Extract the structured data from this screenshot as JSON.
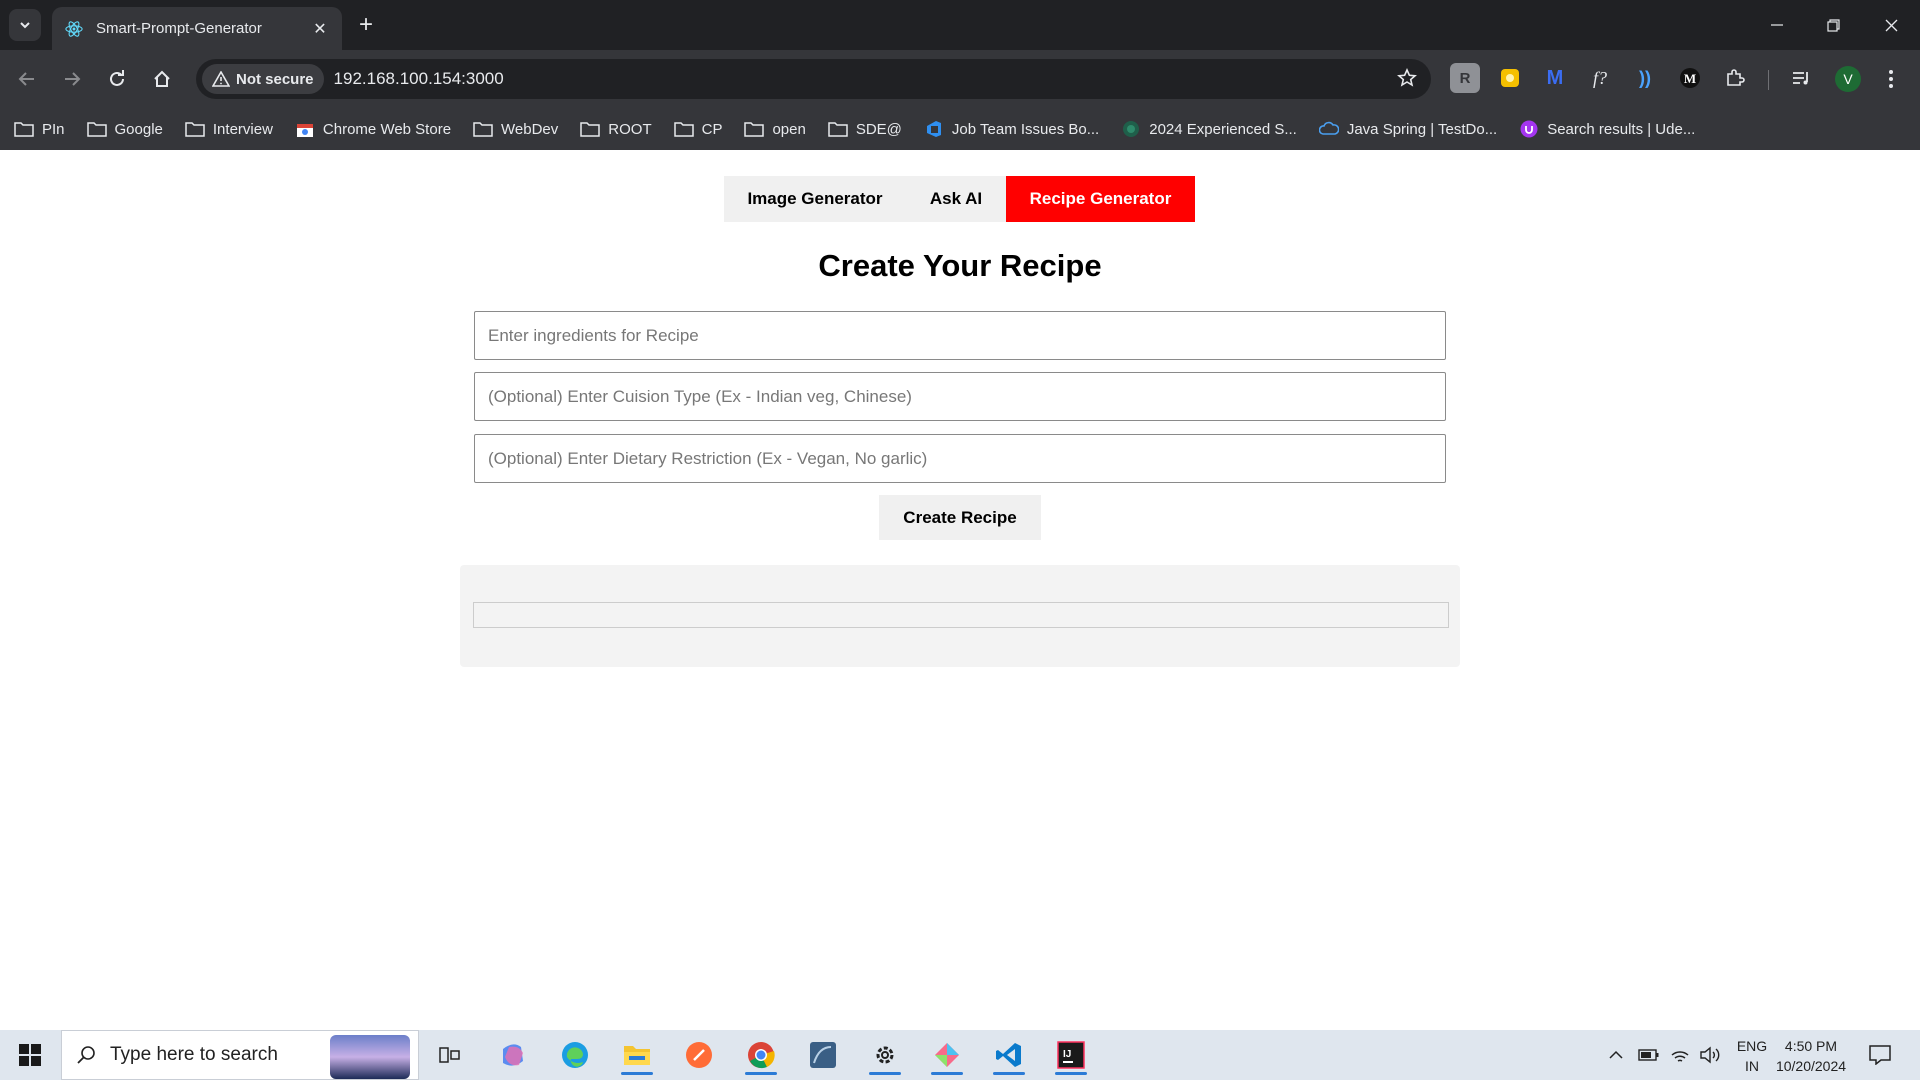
{
  "browser": {
    "tab_title": "Smart-Prompt-Generator",
    "security_label": "Not secure",
    "url": "192.168.100.154:3000",
    "profile_initial": "V",
    "bookmarks": [
      "PIn",
      "Google",
      "Interview",
      "Chrome Web Store",
      "WebDev",
      "ROOT",
      "CP",
      "open",
      "SDE@",
      "Job Team Issues Bo...",
      "2024 Experienced S...",
      "Java Spring | TestDo...",
      "Search results | Ude..."
    ]
  },
  "app": {
    "tabs": [
      "Image Generator",
      "Ask AI",
      "Recipe Generator"
    ],
    "active_tab": "Recipe Generator",
    "heading": "Create Your Recipe",
    "ingredients_placeholder": "Enter ingredients for Recipe",
    "cuisine_placeholder": "(Optional) Enter Cuision Type (Ex - Indian veg, Chinese)",
    "dietary_placeholder": "(Optional) Enter Dietary Restriction (Ex - Vegan, No garlic)",
    "create_button": "Create Recipe",
    "accent_color": "#ff0000"
  },
  "taskbar": {
    "search_placeholder": "Type here to search",
    "language": "ENG",
    "region": "IN",
    "time": "4:50 PM",
    "date": "10/20/2024"
  }
}
